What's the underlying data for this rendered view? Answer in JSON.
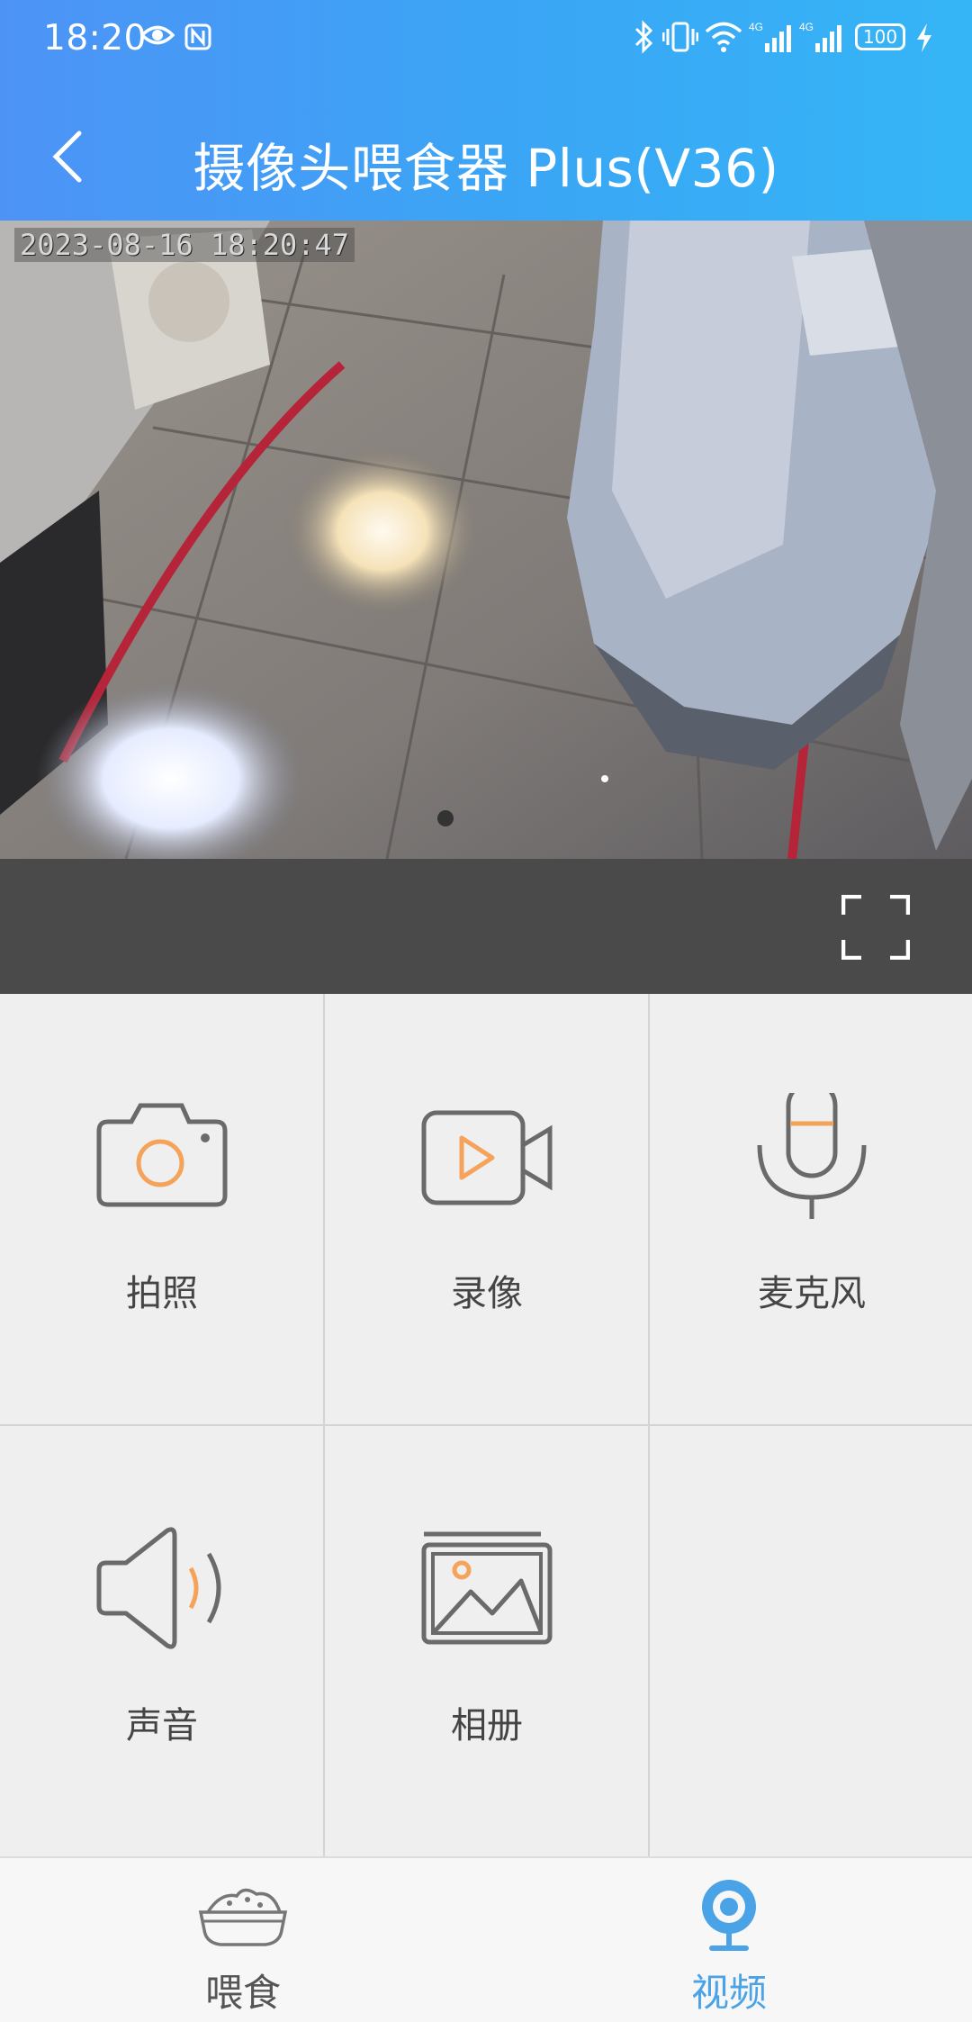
{
  "status_bar": {
    "time": "18:20",
    "icons": [
      "eye-icon",
      "nfc-icon",
      "bluetooth-icon",
      "vibrate-icon",
      "wifi-icon",
      "signal-4g-icon",
      "signal-4g-icon",
      "battery-icon",
      "charging-icon"
    ],
    "battery": "100"
  },
  "header": {
    "title": "摄像头喂食器 Plus(V36)",
    "back_icon": "chevron-left-icon"
  },
  "video": {
    "timestamp": "2023-08-16 18:20:47",
    "fullscreen_icon": "fullscreen-icon"
  },
  "actions": [
    {
      "label": "拍照",
      "icon": "camera-icon"
    },
    {
      "label": "录像",
      "icon": "video-record-icon"
    },
    {
      "label": "麦克风",
      "icon": "microphone-icon"
    },
    {
      "label": "声音",
      "icon": "speaker-icon"
    },
    {
      "label": "相册",
      "icon": "gallery-icon"
    }
  ],
  "tabs": [
    {
      "label": "喂食",
      "icon": "food-bowl-icon",
      "active": false
    },
    {
      "label": "视频",
      "icon": "webcam-icon",
      "active": true
    }
  ],
  "colors": {
    "header_start": "#4d93f6",
    "header_end": "#35b5f6",
    "accent_orange": "#f5a35a",
    "icon_gray": "#6a6a6a",
    "tab_active": "#4aa3e6",
    "tab_inactive": "#555555",
    "control_bar": "#4a4a4a"
  }
}
